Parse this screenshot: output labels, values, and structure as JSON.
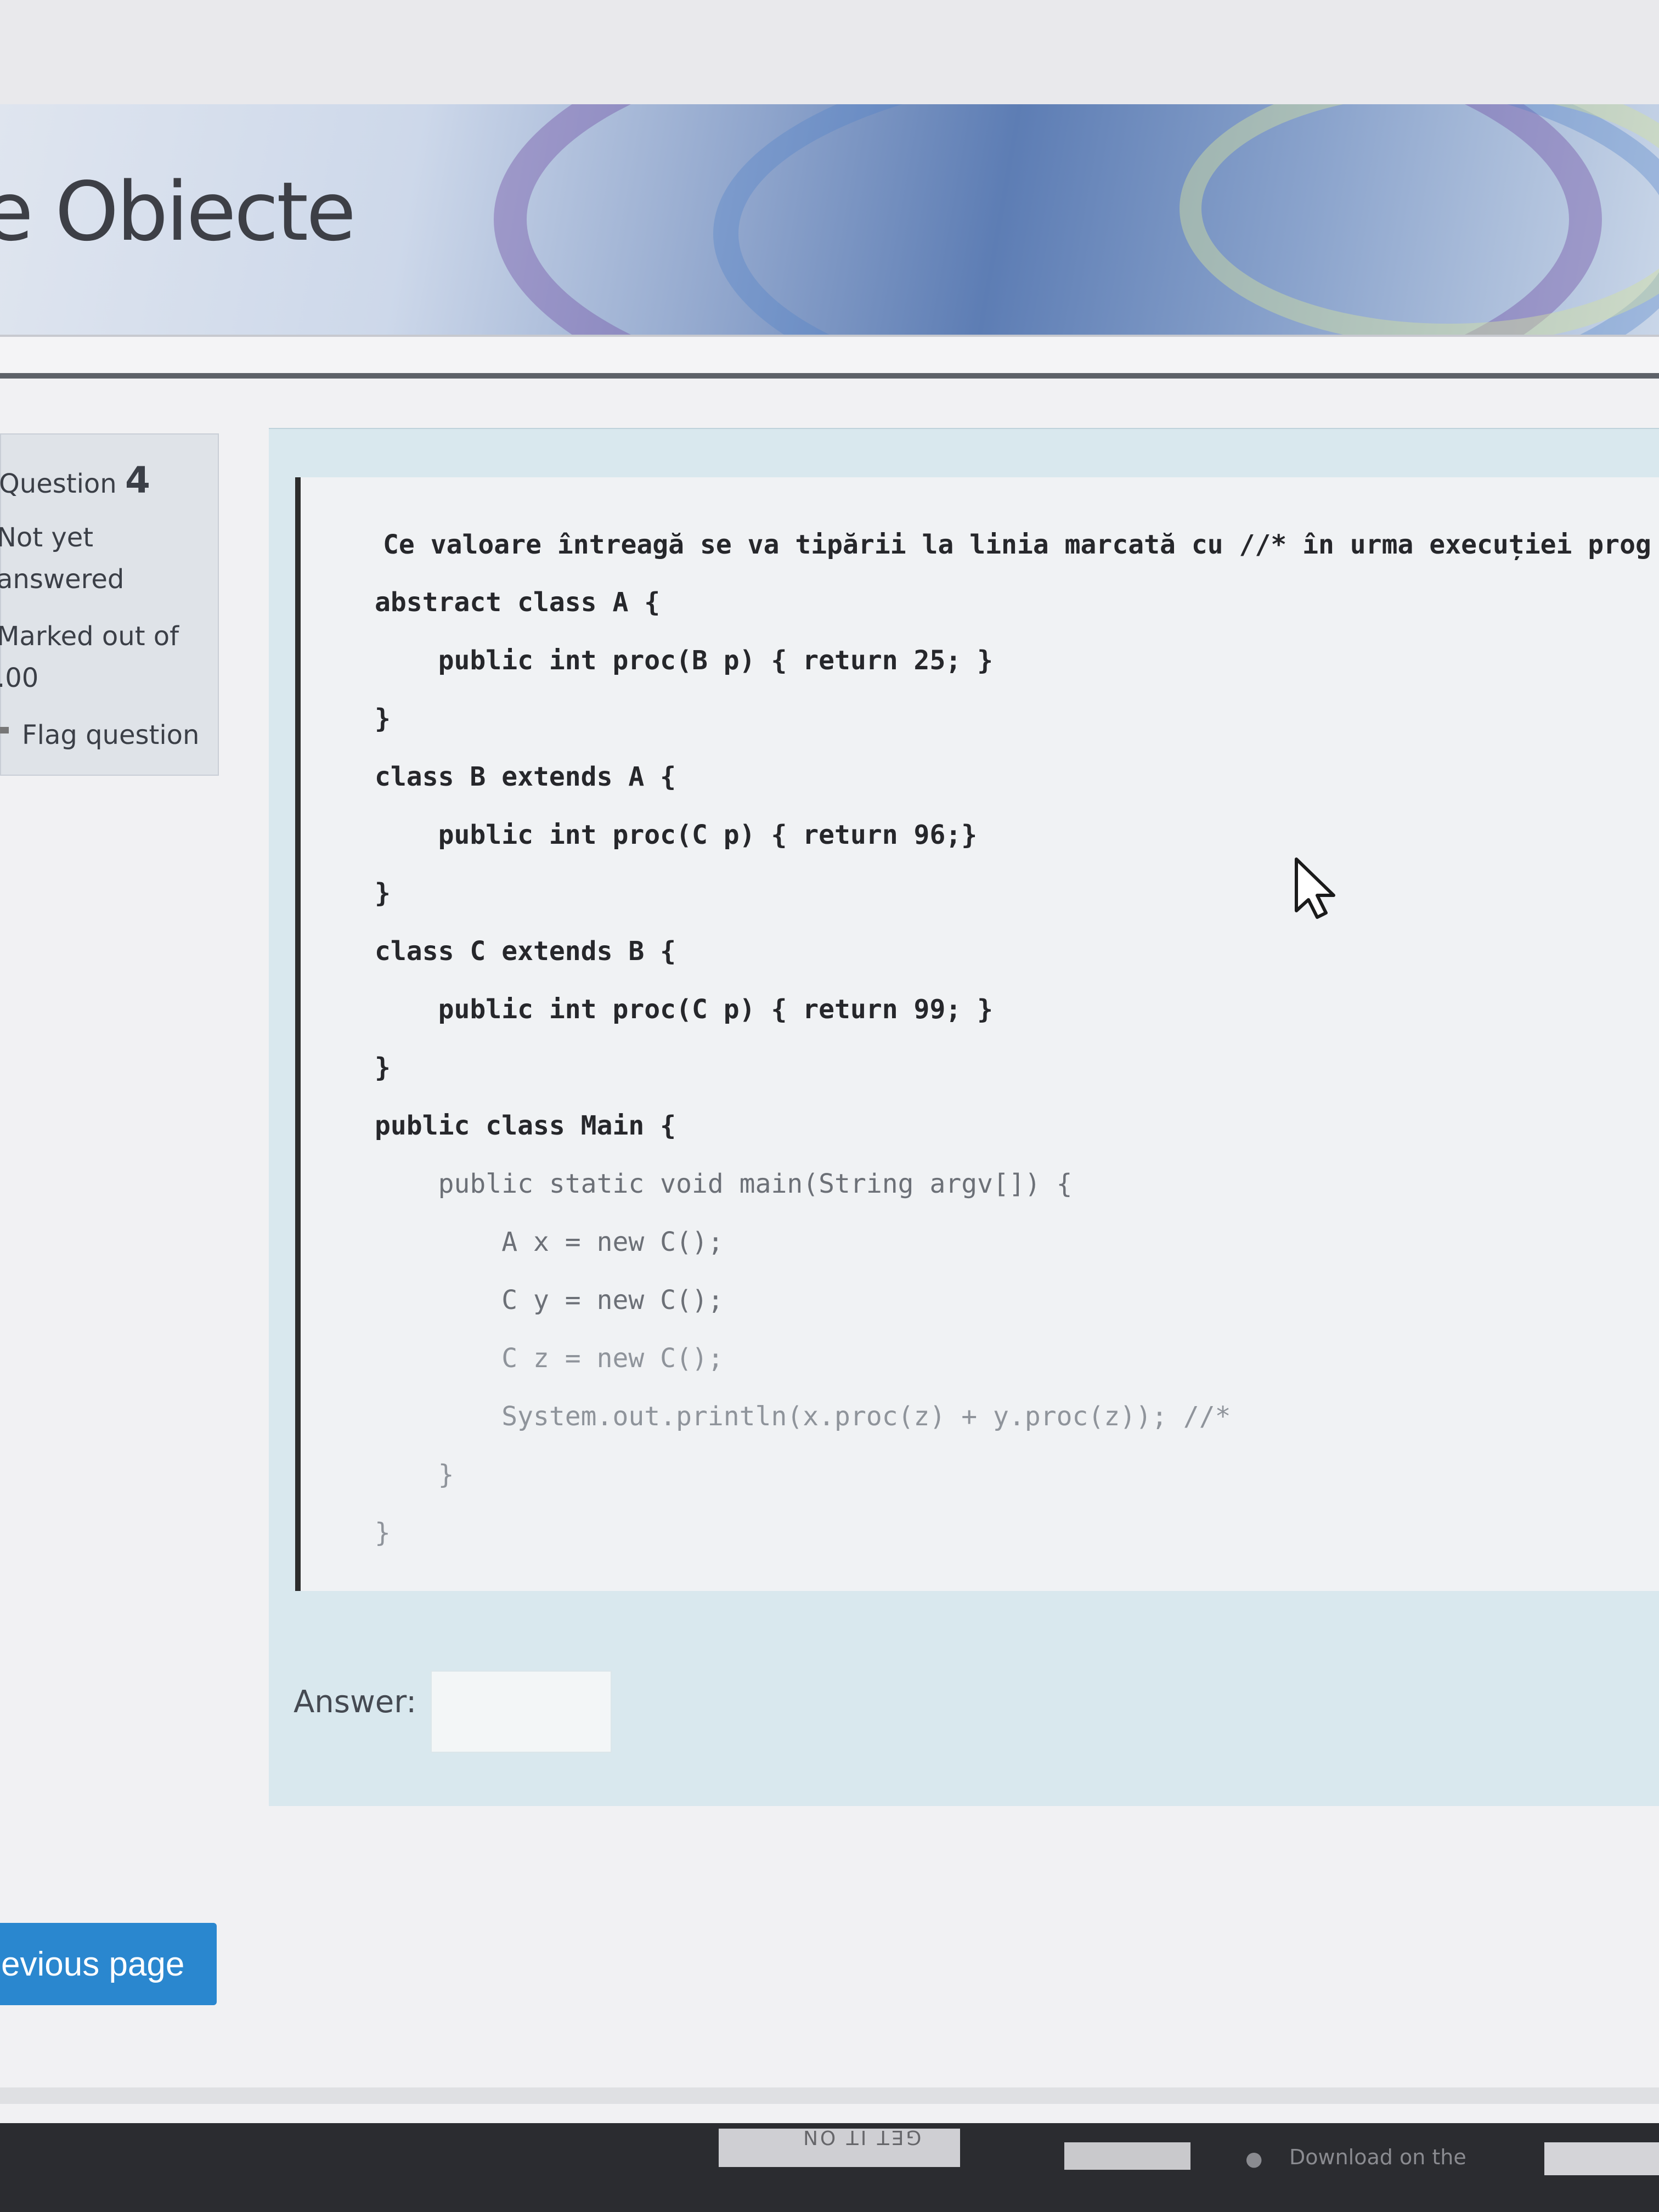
{
  "header": {
    "course_title": "e Obiecte"
  },
  "question_info": {
    "label": "Question",
    "number": "4",
    "state_line1": "Not yet",
    "state_line2": "answered",
    "marked_line1": "Marked out of",
    "marked_line2": ".00",
    "flag_label": "Flag question"
  },
  "question": {
    "prompt": "Ce valoare întreagă se va tipării la linia marcată cu //* în urma execuției prog",
    "code_lines": [
      "abstract class A {",
      "    public int proc(B p) { return 25; }",
      "}",
      "class B extends A {",
      "    public int proc(C p) { return 96;}",
      "}",
      "class C extends B {",
      "    public int proc(C p) { return 99; }",
      "}",
      "public class Main {",
      "    public static void main(String argv[]) {",
      "        A x = new C();",
      "        C y = new C();",
      "        C z = new C();",
      "        System.out.println(x.proc(z) + y.proc(z)); //*",
      "    }",
      "}"
    ]
  },
  "answer": {
    "label": "Answer:",
    "value": ""
  },
  "navigation": {
    "previous_label": "evious page"
  },
  "footer": {
    "google_play_label": "GET IT ON",
    "app_store_label": "Download on the"
  },
  "colors": {
    "button": "#2a87cf",
    "panel": "#d9e8ee",
    "code_border": "#2c2c2c"
  }
}
